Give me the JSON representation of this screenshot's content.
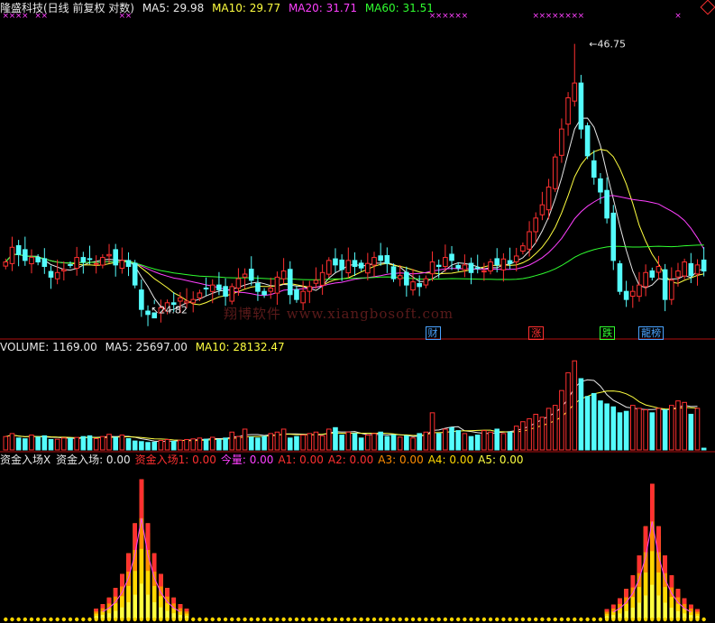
{
  "header": {
    "stock": "隆盛科技(日线 前复权 对数)",
    "ma5": "MA5: 29.98",
    "ma10": "MA10: 29.77",
    "ma20": "MA20: 31.71",
    "ma60": "MA60: 31.51"
  },
  "volume_header": {
    "volume": "VOLUME: 1169.00",
    "ma5": "MA5: 25697.00",
    "ma10": "MA10: 28132.47"
  },
  "indicator_header": {
    "name": "资金入场X",
    "items": [
      {
        "label": "资金入场: 0.00",
        "color": "#e8e8e8"
      },
      {
        "label": "资金入场1: 0.00",
        "color": "#ff3030"
      },
      {
        "label": "今量: 0.00",
        "color": "#ff40ff"
      },
      {
        "label": "A1: 0.00",
        "color": "#ff3030"
      },
      {
        "label": "A2: 0.00",
        "color": "#ff3030"
      },
      {
        "label": "A3: 0.00",
        "color": "#ff8c00"
      },
      {
        "label": "A4: 0.00",
        "color": "#ffd700"
      },
      {
        "label": "A5: 0.00",
        "color": "#ffff40"
      }
    ]
  },
  "annotations": {
    "high": "46.75",
    "low": "24.82",
    "watermark": "翔博软件 www.xiangbosoft.com"
  },
  "badges": [
    {
      "text": "财",
      "color": "#4aa3ff",
      "index": 66
    },
    {
      "text": "涨",
      "color": "#ff3030",
      "index": 82
    },
    {
      "text": "跌",
      "color": "#30ff30",
      "index": 93
    },
    {
      "text": "龍榜",
      "color": "#4aa3ff",
      "index": 99
    }
  ],
  "colors": {
    "up": "#ff3030",
    "down": "#54fcfc",
    "ma5": "#e8e8e8",
    "ma10": "#ffff40",
    "ma20": "#ff40ff",
    "ma60": "#30ff30",
    "divider": "#b01010"
  },
  "chart_data": [
    {
      "type": "candlestick",
      "x": "trading day index (0 = leftmost visible)",
      "ylim": [
        23,
        50
      ],
      "log_scale": true,
      "close": [
        27.5,
        28.5,
        28.0,
        27.6,
        27.8,
        27.5,
        27.2,
        26.5,
        26.8,
        27.0,
        27.3,
        27.8,
        27.5,
        27.7,
        27.4,
        27.8,
        28.0,
        27.3,
        27.6,
        27.2,
        26.0,
        24.5,
        24.2,
        24.0,
        24.6,
        24.9,
        24.8,
        25.2,
        25.0,
        25.1,
        25.5,
        25.8,
        26.0,
        25.7,
        25.3,
        25.9,
        26.4,
        26.7,
        26.3,
        25.6,
        25.4,
        25.8,
        26.5,
        26.9,
        25.4,
        25.1,
        25.6,
        25.9,
        26.3,
        26.8,
        27.6,
        27.3,
        27.0,
        27.6,
        27.2,
        27.1,
        27.4,
        27.8,
        27.6,
        27.4,
        26.4,
        26.6,
        26.0,
        26.2,
        25.9,
        26.4,
        27.5,
        27.2,
        27.8,
        27.6,
        27.1,
        27.3,
        26.8,
        27.1,
        26.9,
        27.5,
        27.3,
        27.7,
        27.4,
        27.9,
        28.6,
        29.6,
        30.6,
        31.6,
        33.0,
        35.5,
        38.0,
        41.0,
        42.5,
        38.0,
        35.6,
        33.8,
        32.6,
        30.6,
        27.6,
        25.6,
        25.1,
        25.6,
        26.0,
        26.8,
        26.5,
        27.2,
        25.1,
        26.3,
        26.9,
        27.5,
        26.6,
        27.3,
        26.9
      ],
      "volume": [
        9000,
        11000,
        8000,
        7500,
        10000,
        8600,
        9500,
        7000,
        7200,
        8000,
        7800,
        8400,
        9000,
        9500,
        7600,
        9000,
        10500,
        8400,
        10000,
        7600,
        6000,
        5600,
        5000,
        5200,
        6400,
        7000,
        5800,
        6500,
        7000,
        7400,
        8000,
        7200,
        8500,
        7000,
        8000,
        12000,
        9000,
        14000,
        8600,
        8000,
        9000,
        11000,
        12000,
        14000,
        8000,
        9000,
        10000,
        11000,
        12000,
        9500,
        14000,
        15000,
        10000,
        12000,
        11000,
        8000,
        10000,
        11000,
        12000,
        9000,
        10000,
        8600,
        9500,
        8000,
        11000,
        12000,
        25000,
        11000,
        14000,
        15000,
        13000,
        11000,
        9000,
        10000,
        13000,
        12000,
        14000,
        11000,
        12000,
        16000,
        19000,
        21000,
        24000,
        22000,
        28000,
        30000,
        40000,
        52000,
        60000,
        48000,
        36000,
        38000,
        33000,
        31000,
        29000,
        25000,
        26000,
        30000,
        28000,
        27000,
        25000,
        28000,
        27000,
        30000,
        33000,
        32000,
        24000,
        28000,
        1169
      ],
      "volume_ylim": [
        0,
        65000
      ]
    },
    {
      "type": "bar",
      "x": "trading day index",
      "series_name": "资金入场X",
      "ylim": [
        0,
        100
      ],
      "peaks": [
        {
          "center": 21,
          "height": 93
        },
        {
          "center": 100,
          "height": 90
        }
      ]
    }
  ]
}
